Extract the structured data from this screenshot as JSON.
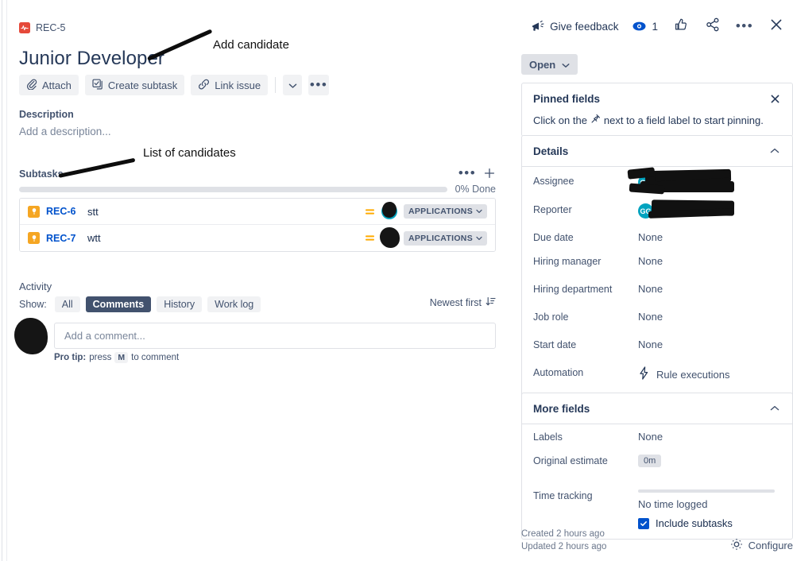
{
  "breadcrumb": {
    "key": "REC-5",
    "icon": "issue-type-story-icon"
  },
  "header": {
    "title": "Junior Developer",
    "actions": [
      {
        "label": "Attach",
        "icon": "paperclip-icon"
      },
      {
        "label": "Create subtask",
        "icon": "subtask-icon"
      },
      {
        "label": "Link issue",
        "icon": "link-icon"
      }
    ],
    "caret_icon": "chevron-down-icon",
    "more_icon": "more-horizontal-icon"
  },
  "topbar": {
    "feedback_label": "Give feedback",
    "feedback_icon": "megaphone-icon",
    "watch_icon": "eye-icon",
    "watch_count": "1",
    "like_icon": "thumbs-up-icon",
    "share_icon": "share-icon",
    "more_icon": "more-horizontal-icon",
    "close_icon": "close-icon"
  },
  "description": {
    "label": "Description",
    "placeholder": "Add a description..."
  },
  "subtasks": {
    "label": "Subtasks",
    "more_icon": "more-horizontal-icon",
    "add_icon": "plus-icon",
    "progress_percent": 0,
    "progress_text": "0% Done",
    "rows": [
      {
        "key": "REC-6",
        "summary": "stt",
        "type_icon": "candidate-icon",
        "priority_icon": "priority-medium-icon",
        "status": "APPLICATIONS",
        "status_caret": "chevron-down-icon"
      },
      {
        "key": "REC-7",
        "summary": "wtt",
        "type_icon": "candidate-icon",
        "priority_icon": "priority-medium-icon",
        "status": "APPLICATIONS",
        "status_caret": "chevron-down-icon"
      }
    ]
  },
  "activity": {
    "label": "Activity",
    "show_label": "Show:",
    "filters": [
      {
        "label": "All",
        "active": false
      },
      {
        "label": "Comments",
        "active": true
      },
      {
        "label": "History",
        "active": false
      },
      {
        "label": "Work log",
        "active": false
      }
    ],
    "sort_label": "Newest first",
    "sort_icon": "sort-descending-icon",
    "comment_placeholder": "Add a comment...",
    "tip_prefix": "Pro tip:",
    "tip_press": "press",
    "tip_key": "M",
    "tip_suffix": "to comment"
  },
  "sidebar": {
    "status": {
      "label": "Open",
      "caret_icon": "chevron-down-icon"
    },
    "pinned": {
      "title": "Pinned fields",
      "close_icon": "close-icon",
      "text_before": "Click on the",
      "pin_icon": "pin-icon",
      "text_after": "next to a field label to start pinning."
    },
    "details": {
      "title": "Details",
      "collapse_icon": "chevron-up-icon",
      "fields": [
        {
          "label": "Assignee",
          "value": "",
          "kind": "avatar-redacted",
          "avatar_initials": "GG"
        },
        {
          "label": "Reporter",
          "value": "",
          "kind": "avatar-redacted",
          "avatar_initials": "GG"
        },
        {
          "label": "Due date",
          "value": "None",
          "kind": "text"
        },
        {
          "label": "Hiring manager",
          "value": "None",
          "kind": "text"
        },
        {
          "label": "Hiring department",
          "value": "None",
          "kind": "text"
        },
        {
          "label": "Job role",
          "value": "None",
          "kind": "text"
        },
        {
          "label": "Start date",
          "value": "None",
          "kind": "text"
        },
        {
          "label": "Automation",
          "value": "Rule executions",
          "kind": "automation",
          "icon": "lightning-bolt-icon"
        }
      ]
    },
    "more_fields": {
      "title": "More fields",
      "collapse_icon": "chevron-up-icon",
      "labels_label": "Labels",
      "labels_value": "None",
      "estimate_label": "Original estimate",
      "estimate_value": "0m",
      "time_label": "Time tracking",
      "time_value": "No time logged",
      "include_subtasks_label": "Include subtasks",
      "include_subtasks_checked": true,
      "check_icon": "check-icon"
    },
    "footer": {
      "created": "Created 2 hours ago",
      "updated": "Updated 2 hours ago",
      "configure_label": "Configure",
      "configure_icon": "gear-icon"
    }
  },
  "annotations": [
    {
      "text": "Add candidate"
    },
    {
      "text": "List of candidates"
    }
  ],
  "colors": {
    "accent": "#0052cc",
    "link": "#0052cc",
    "subtask_type": "#f5a623",
    "story_type": "#e5493a",
    "avatar": "#00a3bf",
    "priority_medium": "#ffab00"
  }
}
